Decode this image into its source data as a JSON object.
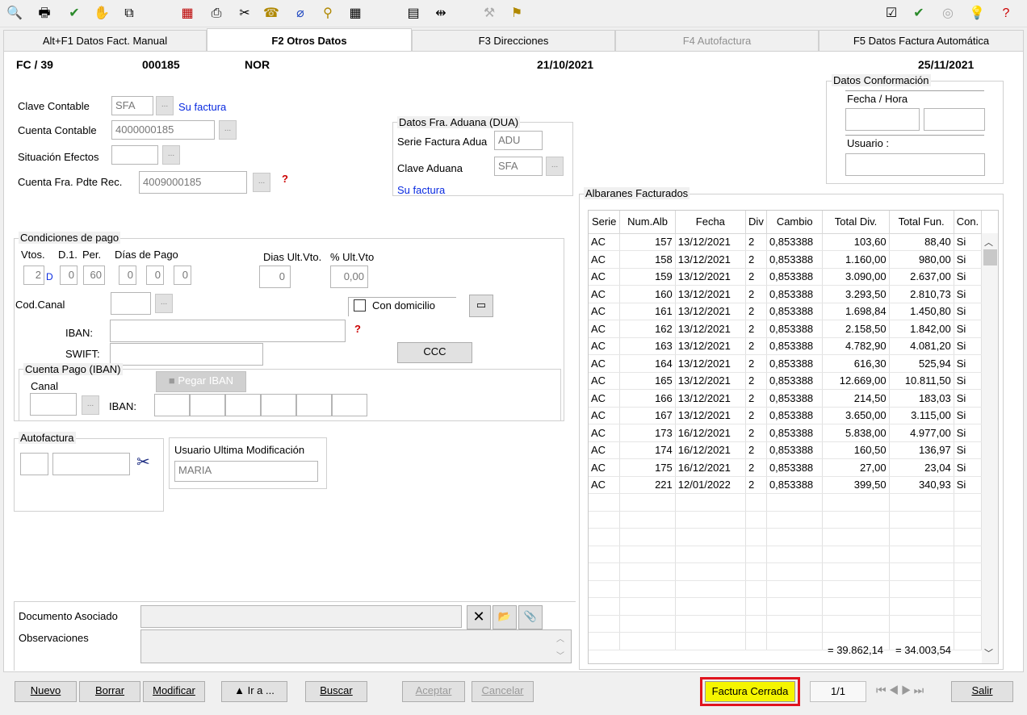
{
  "toolbar": {
    "left_icons": [
      "preview-icon",
      "print-icon",
      "validate-icon",
      "disabled-hand-icon",
      "copy-icon",
      "calc-icon",
      "printer2-icon",
      "cut-icon",
      "phone-icon",
      "clip-icon",
      "attach-icon",
      "calendar-icon",
      "grid-icon",
      "split-icon",
      "disabled-tool-icon",
      "ruler-icon"
    ],
    "right_icons": [
      "checkbox-icon",
      "approve-icon",
      "view-icon",
      "bulb-icon",
      "help-icon"
    ]
  },
  "tabs": [
    {
      "label": "Alt+F1 Datos Fact. Manual",
      "state": "normal"
    },
    {
      "label": "F2 Otros Datos",
      "state": "active"
    },
    {
      "label": "F3 Direcciones",
      "state": "normal"
    },
    {
      "label": "F4 Autofactura",
      "state": "disabled"
    },
    {
      "label": "F5 Datos Factura Automática",
      "state": "normal"
    }
  ],
  "header": {
    "serie": "FC / 39",
    "numero": "000185",
    "code": "NOR",
    "fecha1": "21/10/2021",
    "fecha2": "25/11/2021"
  },
  "clave": {
    "clave_contable_label": "Clave Contable",
    "clave_contable_value": "SFA",
    "su_factura": "Su factura",
    "cuenta_contable_label": "Cuenta Contable",
    "cuenta_contable_value": "4000000185",
    "situacion_label": "Situación Efectos",
    "situacion_value": "",
    "cuenta_pdte_label": "Cuenta Fra. Pdte Rec.",
    "cuenta_pdte_value": "4009000185"
  },
  "dua": {
    "title": "Datos Fra. Aduana (DUA)",
    "serie_label": "Serie Factura Adua",
    "serie_value": "ADU",
    "clave_label": "Clave Aduana",
    "clave_value": "SFA",
    "link": "Su factura"
  },
  "conformacion": {
    "title": "Datos Conformación",
    "fecha_label": "Fecha / Hora",
    "usuario_label": "Usuario :"
  },
  "pago": {
    "title": "Condiciones de pago",
    "vtos_label": "Vtos.",
    "d1_label": "D.1.",
    "per_label": "Per.",
    "dias_label": "Días de Pago",
    "vtos": "2",
    "vtos_suffix": "D",
    "d1": "0",
    "per": "60",
    "dias": [
      "0",
      "0",
      "0"
    ],
    "dias_ult_label": "Dias Ult.Vto.",
    "dias_ult": "0",
    "pct_ult_label": "% Ult.Vto",
    "pct_ult": "0,00",
    "cod_canal_label": "Cod.Canal",
    "con_domicilio": "Con domicilio",
    "iban_label": "IBAN:",
    "swift_label": "SWIFT:",
    "ccc": "CCC",
    "cuenta_pago_title": "Cuenta Pago (IBAN)",
    "canal_label": "Canal",
    "iban2_label": "IBAN:",
    "pegar_iban": "Pegar IBAN"
  },
  "autofactura": {
    "title": "Autofactura",
    "usuario_title": "Usuario Ultima Modificación",
    "usuario": "MARIA"
  },
  "documento": {
    "doc_label": "Documento Asociado",
    "obs_label": "Observaciones"
  },
  "albaranes": {
    "title": "Albaranes Facturados",
    "columns": [
      "Serie",
      "Num.Alb",
      "Fecha",
      "Div",
      "Cambio",
      "Total Div.",
      "Total Fun.",
      "Con."
    ],
    "rows": [
      [
        "AC",
        "157",
        "13/12/2021",
        "2",
        "0,853388",
        "103,60",
        "88,40",
        "Si"
      ],
      [
        "AC",
        "158",
        "13/12/2021",
        "2",
        "0,853388",
        "1.160,00",
        "980,00",
        "Si"
      ],
      [
        "AC",
        "159",
        "13/12/2021",
        "2",
        "0,853388",
        "3.090,00",
        "2.637,00",
        "Si"
      ],
      [
        "AC",
        "160",
        "13/12/2021",
        "2",
        "0,853388",
        "3.293,50",
        "2.810,73",
        "Si"
      ],
      [
        "AC",
        "161",
        "13/12/2021",
        "2",
        "0,853388",
        "1.698,84",
        "1.450,80",
        "Si"
      ],
      [
        "AC",
        "162",
        "13/12/2021",
        "2",
        "0,853388",
        "2.158,50",
        "1.842,00",
        "Si"
      ],
      [
        "AC",
        "163",
        "13/12/2021",
        "2",
        "0,853388",
        "4.782,90",
        "4.081,20",
        "Si"
      ],
      [
        "AC",
        "164",
        "13/12/2021",
        "2",
        "0,853388",
        "616,30",
        "525,94",
        "Si"
      ],
      [
        "AC",
        "165",
        "13/12/2021",
        "2",
        "0,853388",
        "12.669,00",
        "10.811,50",
        "Si"
      ],
      [
        "AC",
        "166",
        "13/12/2021",
        "2",
        "0,853388",
        "214,50",
        "183,03",
        "Si"
      ],
      [
        "AC",
        "167",
        "13/12/2021",
        "2",
        "0,853388",
        "3.650,00",
        "3.115,00",
        "Si"
      ],
      [
        "AC",
        "173",
        "16/12/2021",
        "2",
        "0,853388",
        "5.838,00",
        "4.977,00",
        "Si"
      ],
      [
        "AC",
        "174",
        "16/12/2021",
        "2",
        "0,853388",
        "160,50",
        "136,97",
        "Si"
      ],
      [
        "AC",
        "175",
        "16/12/2021",
        "2",
        "0,853388",
        "27,00",
        "23,04",
        "Si"
      ],
      [
        "AC",
        "221",
        "12/01/2022",
        "2",
        "0,853388",
        "399,50",
        "340,93",
        "Si"
      ]
    ],
    "total_div": "= 39.862,14",
    "total_fun": "= 34.003,54"
  },
  "bottom": {
    "nuevo": "Nuevo",
    "borrar": "Borrar",
    "modificar": "Modificar",
    "ira": "▲ Ir a ...",
    "buscar": "Buscar",
    "aceptar": "Aceptar",
    "cancelar": "Cancelar",
    "estado": "Factura Cerrada",
    "pagina": "1/1",
    "salir": "Salir"
  },
  "colors": {
    "accent_link": "#0a2be0",
    "status_bg": "#f5f500",
    "status_border": "#e0141e"
  }
}
